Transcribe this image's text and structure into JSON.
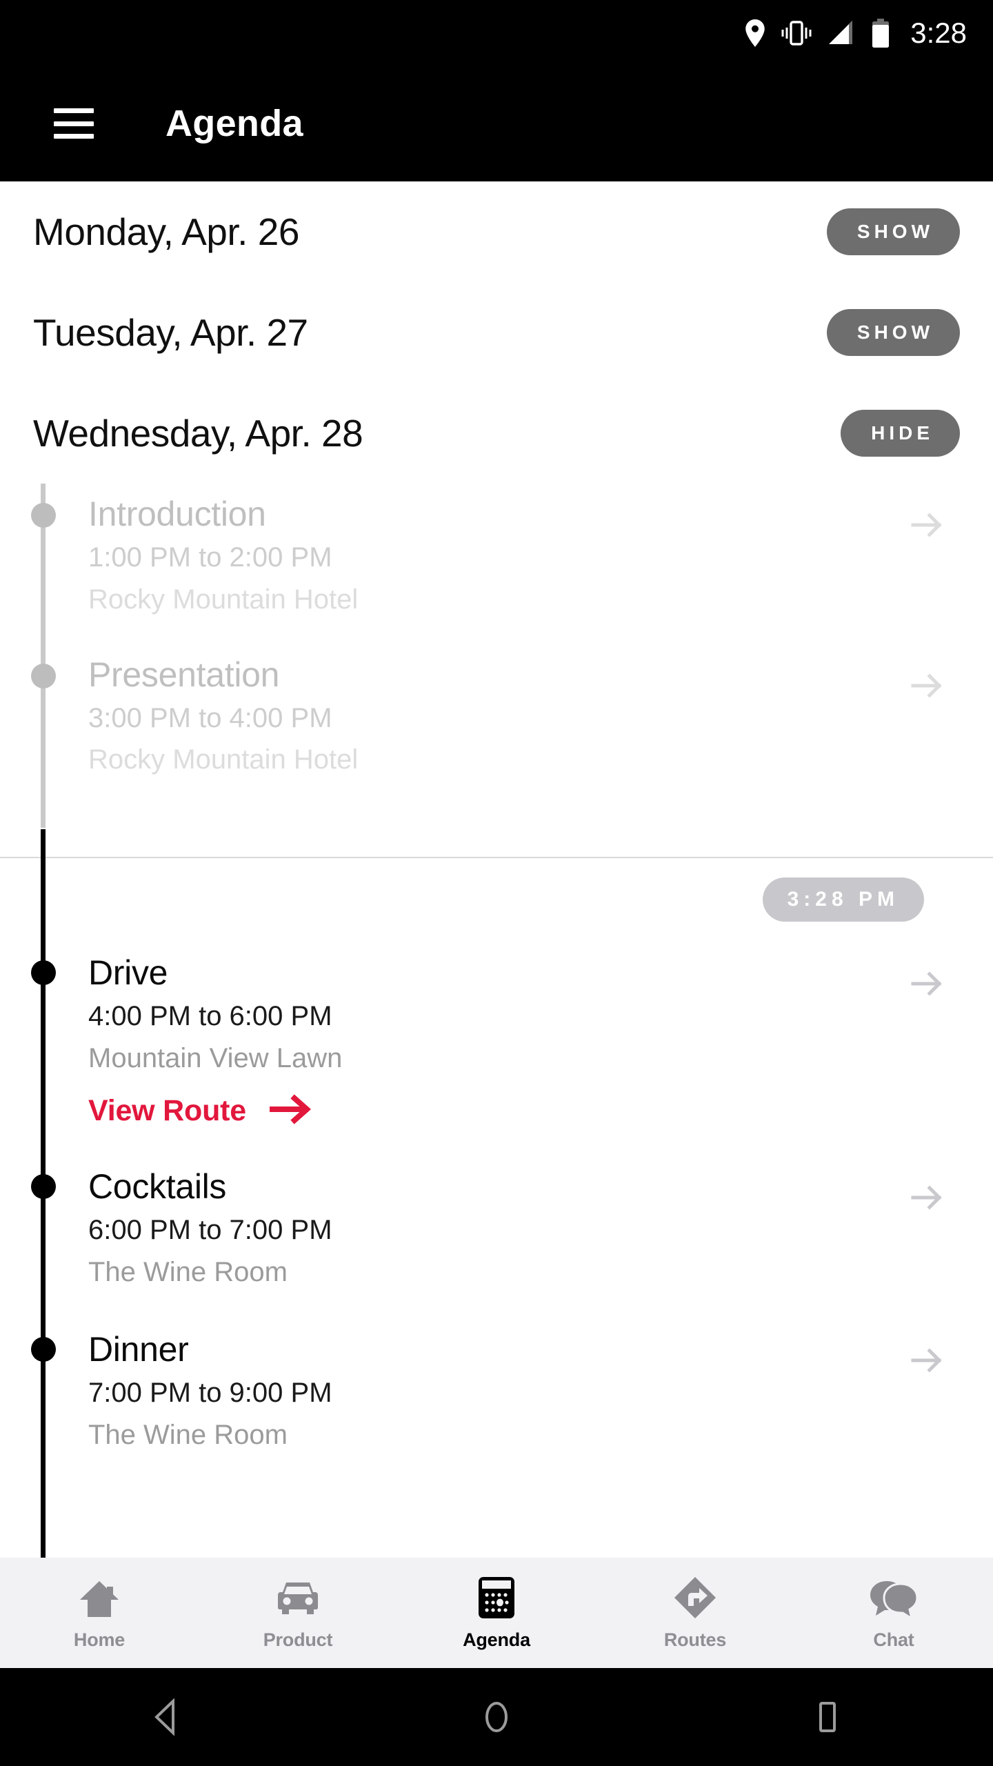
{
  "status_bar": {
    "time": "3:28",
    "icons": [
      "location-pin-icon",
      "vibrate-icon",
      "signal-icon",
      "battery-icon"
    ]
  },
  "app_bar": {
    "menu_icon": "hamburger-menu-icon",
    "title": "Agenda"
  },
  "days": [
    {
      "label": "Monday, Apr. 26",
      "toggle": "SHOW",
      "expanded": false
    },
    {
      "label": "Tuesday, Apr. 27",
      "toggle": "SHOW",
      "expanded": false
    },
    {
      "label": "Wednesday, Apr. 28",
      "toggle": "HIDE",
      "expanded": true
    }
  ],
  "now_marker": {
    "time": "3:28 PM"
  },
  "events": [
    {
      "title": "Introduction",
      "time": "1:00 PM to 2:00 PM",
      "place": "Rocky Mountain Hotel",
      "state": "past"
    },
    {
      "title": "Presentation",
      "time": "3:00 PM to 4:00 PM",
      "place": "Rocky Mountain Hotel",
      "state": "past"
    },
    {
      "title": "Drive",
      "time": "4:00 PM to 6:00 PM",
      "place": "Mountain View Lawn",
      "state": "active",
      "route_link": "View Route"
    },
    {
      "title": "Cocktails",
      "time": "6:00 PM to 7:00 PM",
      "place": "The Wine Room",
      "state": "active"
    },
    {
      "title": "Dinner",
      "time": "7:00 PM to 9:00 PM",
      "place": "The Wine Room",
      "state": "active"
    }
  ],
  "tabs": [
    {
      "label": "Home",
      "icon": "home-icon",
      "active": false
    },
    {
      "label": "Product",
      "icon": "car-icon",
      "active": false
    },
    {
      "label": "Agenda",
      "icon": "calendar-icon",
      "active": true
    },
    {
      "label": "Routes",
      "icon": "route-sign-icon",
      "active": false
    },
    {
      "label": "Chat",
      "icon": "chat-bubbles-icon",
      "active": false
    }
  ],
  "nav_bar": {
    "back": "back-triangle-icon",
    "home": "home-circle-icon",
    "recents": "recents-square-icon"
  },
  "colors": {
    "accent_red": "#e2173c",
    "toggle_grey": "#6e6e6e",
    "badge_grey": "#c8c8cc",
    "tabbar_bg": "#f2f1f3",
    "past_text": "#c6c6c6"
  }
}
